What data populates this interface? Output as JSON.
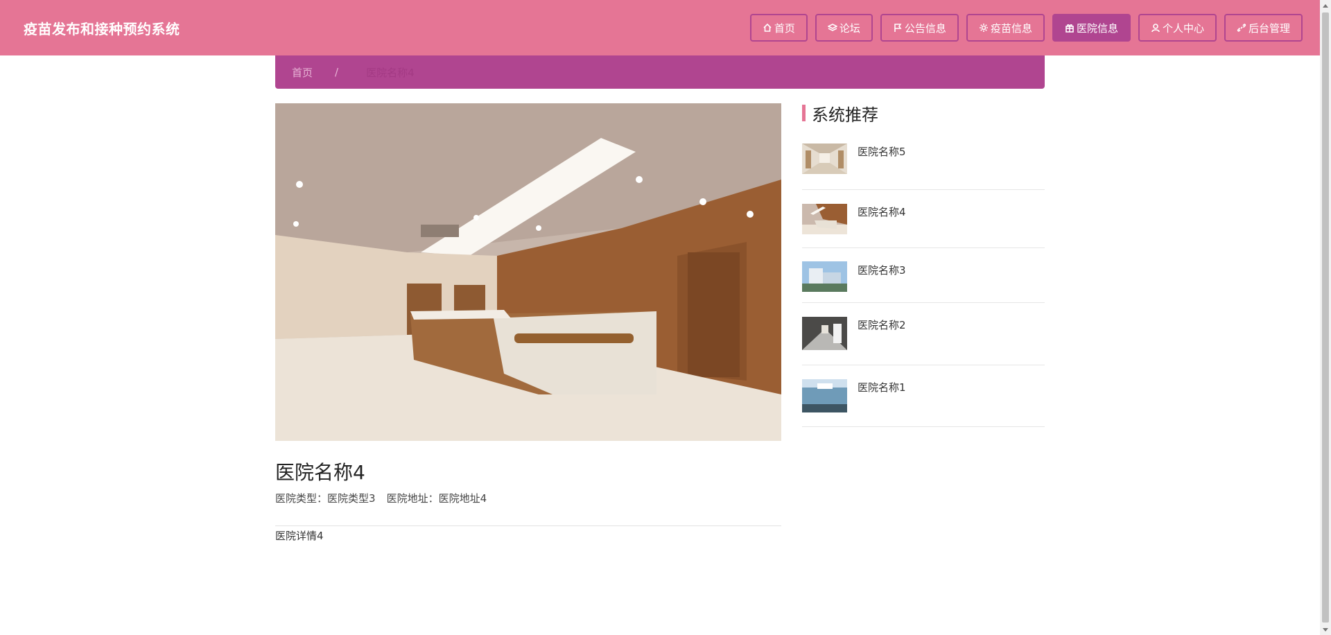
{
  "header": {
    "title": "疫苗发布和接种预约系统",
    "nav": [
      {
        "label": "首页",
        "icon": "home-icon"
      },
      {
        "label": "论坛",
        "icon": "layers-icon"
      },
      {
        "label": "公告信息",
        "icon": "flag-icon"
      },
      {
        "label": "疫苗信息",
        "icon": "gear-icon"
      },
      {
        "label": "医院信息",
        "icon": "gift-icon",
        "active": true
      },
      {
        "label": "个人中心",
        "icon": "user-icon"
      },
      {
        "label": "后台管理",
        "icon": "link-icon"
      }
    ]
  },
  "breadcrumb": {
    "home": "首页",
    "separator": "/",
    "current": "医院名称4"
  },
  "detail": {
    "title": "医院名称4",
    "type_label": "医院类型：",
    "type_value": "医院类型3",
    "address_label": "医院地址：",
    "address_value": "医院地址4",
    "body": "医院详情4"
  },
  "sidebar": {
    "heading": "系统推荐",
    "items": [
      {
        "name": "医院名称5",
        "thumb": "corridor-photo"
      },
      {
        "name": "医院名称4",
        "thumb": "reception-photo"
      },
      {
        "name": "医院名称3",
        "thumb": "building-photo"
      },
      {
        "name": "医院名称2",
        "thumb": "hallway-photo"
      },
      {
        "name": "医院名称1",
        "thumb": "facade-photo"
      }
    ]
  },
  "colors": {
    "header": "#e57595",
    "accent": "#b04590"
  }
}
